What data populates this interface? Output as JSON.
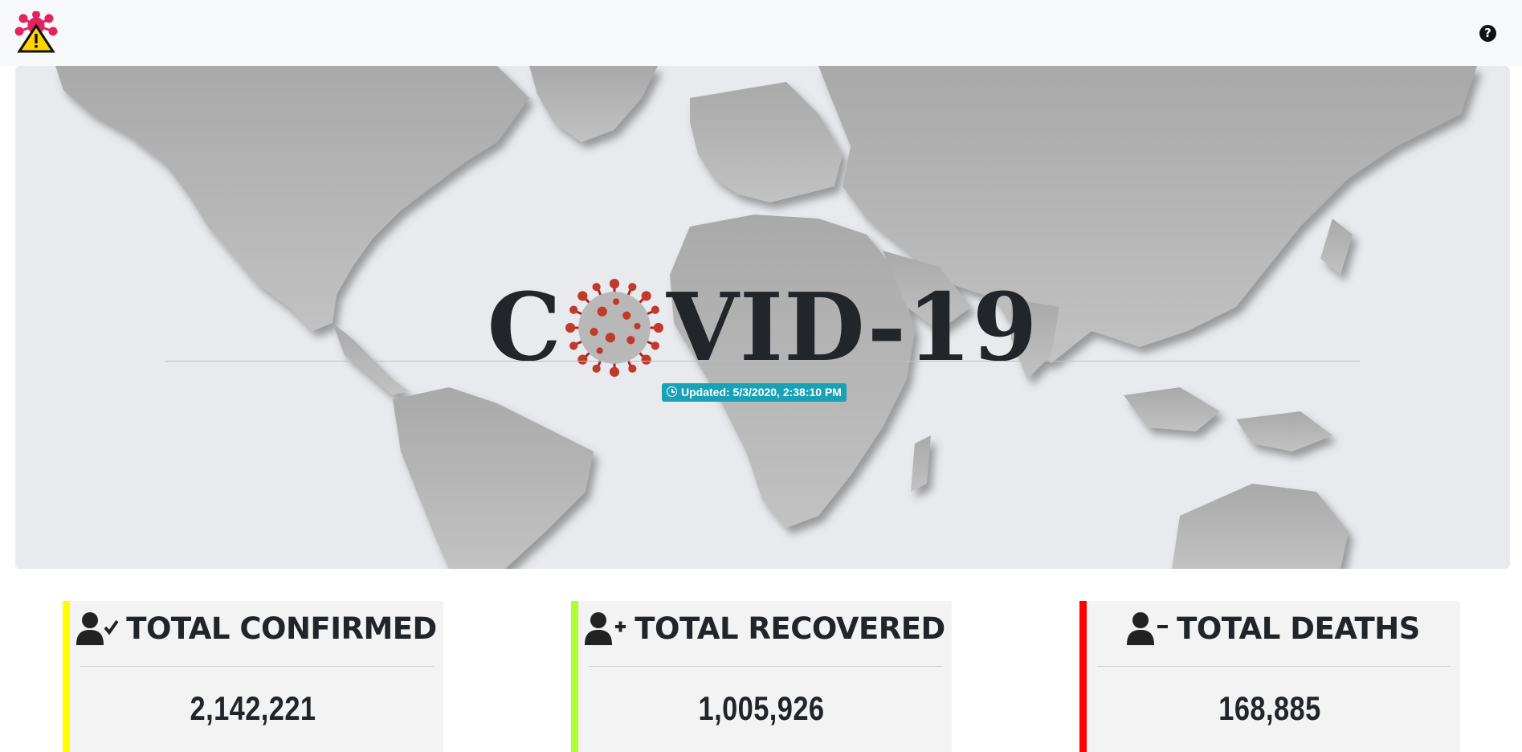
{
  "navbar": {
    "logo_icon": "virus-warning-logo-icon",
    "help_icon": "question-circle-icon",
    "help_glyph": "?"
  },
  "hero": {
    "title_first": "C",
    "title_rest": "VID-19",
    "title_o_icon": "coronavirus-icon",
    "updated_label": "Updated: 5/3/2020, 2:38:10 PM",
    "updated_icon": "clock-icon"
  },
  "cards": [
    {
      "title": "TOTAL CONFIRMED",
      "value": "2,142,221",
      "icon": "user-check-icon",
      "accent": "#ffff00"
    },
    {
      "title": "TOTAL RECOVERED",
      "value": "1,005,926",
      "icon": "user-plus-icon",
      "accent": "#adff2f"
    },
    {
      "title": "TOTAL DEATHS",
      "value": "168,885",
      "icon": "user-minus-icon",
      "accent": "#ff0000"
    }
  ],
  "colors": {
    "badge": "#17a2b8",
    "hero_bg": "#e8eaed",
    "land": "#b8b8b8",
    "text": "#212529"
  }
}
